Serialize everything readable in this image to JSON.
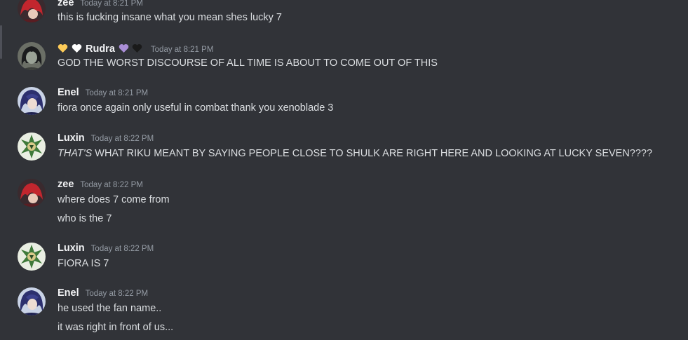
{
  "messages": [
    {
      "author": "zee",
      "timestamp": "Today at 8:21 PM",
      "avatar_icon": "red-haired-anime-avatar",
      "lines": [
        "this is fucking insane what you mean shes lucky 7"
      ]
    },
    {
      "author": "Rudra",
      "timestamp": "Today at 8:21 PM",
      "avatar_icon": "dark-haired-avatar",
      "name_decorations": {
        "before": [
          "yellow-heart-icon",
          "white-heart-icon"
        ],
        "after": [
          "purple-heart-icon",
          "black-heart-icon"
        ],
        "colors": {
          "yellow": "#fdcb58",
          "white": "#ffffff",
          "purple": "#aa8ed6",
          "black": "#1a1a1a"
        }
      },
      "lines": [
        "GOD THE WORST DISCOURSE OF ALL TIME IS ABOUT TO COME OUT OF THIS"
      ]
    },
    {
      "author": "Enel",
      "timestamp": "Today at 8:21 PM",
      "avatar_icon": "blue-haired-anime-avatar",
      "lines": [
        "fiora once again only useful in combat thank you xenoblade 3"
      ]
    },
    {
      "author": "Luxin",
      "timestamp": "Today at 8:22 PM",
      "avatar_icon": "green-knight-avatar",
      "lines_rich": {
        "italic": "THAT'S",
        "rest": " WHAT RIKU MEANT BY SAYING PEOPLE CLOSE TO SHULK ARE RIGHT HERE AND LOOKING AT LUCKY SEVEN????"
      }
    },
    {
      "author": "zee",
      "timestamp": "Today at 8:22 PM",
      "avatar_icon": "red-haired-anime-avatar",
      "lines": [
        "where does 7 come from",
        "who is the 7"
      ]
    },
    {
      "author": "Luxin",
      "timestamp": "Today at 8:22 PM",
      "avatar_icon": "green-knight-avatar",
      "lines": [
        "FIORA IS 7"
      ]
    },
    {
      "author": "Enel",
      "timestamp": "Today at 8:22 PM",
      "avatar_icon": "blue-haired-anime-avatar",
      "lines": [
        "he used the fan name..",
        "it was right in front of us..."
      ]
    }
  ]
}
